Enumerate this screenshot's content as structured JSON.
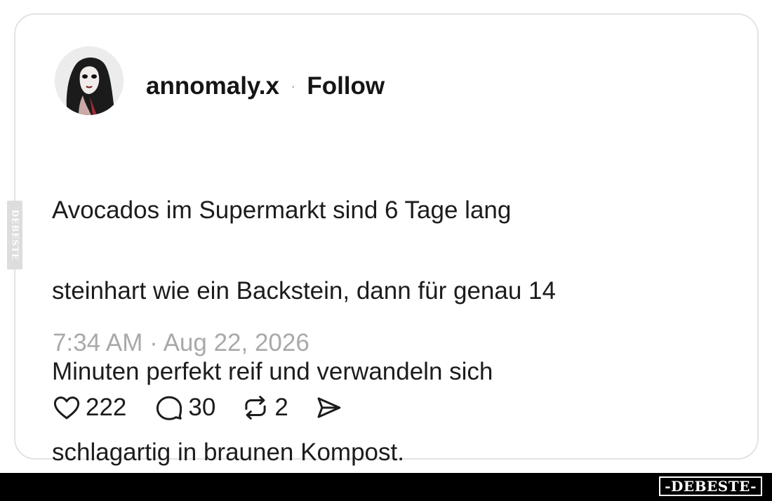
{
  "post": {
    "username": "annomaly.x",
    "separator": "·",
    "follow_label": "Follow",
    "text_lines": [
      "Avocados im Supermarkt sind 6 Tage lang",
      "steinhart wie ein Backstein, dann für genau 14",
      "Minuten perfekt reif und verwandeln sich",
      "schlagartig in braunen Kompost."
    ],
    "timestamp": "7:34 AM · Aug 22, 2026"
  },
  "actions": {
    "like": {
      "icon": "heart-icon",
      "count": "222"
    },
    "reply": {
      "icon": "comment-icon",
      "count": "30"
    },
    "repost": {
      "icon": "repost-icon",
      "count": "2"
    },
    "share": {
      "icon": "send-icon"
    }
  },
  "watermark": {
    "side_text": "DEBESTE",
    "logo_text": "-DEBESTE-"
  },
  "colors": {
    "text": "#1c1c1c",
    "muted": "#a9a9a9",
    "card_border": "#e3e3e3",
    "bottom_bar": "#000000"
  }
}
